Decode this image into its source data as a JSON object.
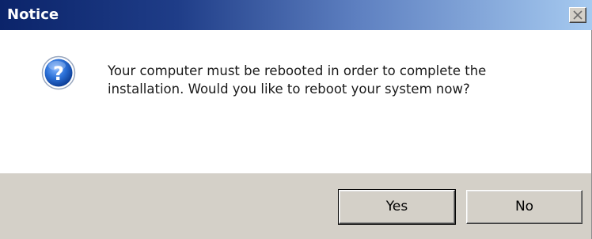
{
  "window": {
    "title": "Notice",
    "close_glyph": "✕"
  },
  "message": {
    "line1": "Your computer must be rebooted in order to complete the",
    "line2": "installation. Would you like to reboot your system now?"
  },
  "icon": {
    "name": "question-icon",
    "glyph": "?"
  },
  "buttons": {
    "yes_label": "Yes",
    "no_label": "No"
  },
  "colors": {
    "title_gradient_start": "#0b246a",
    "title_gradient_end": "#a6caf0",
    "button_face": "#d4d0c8",
    "icon_blue": "#1f5fbf"
  }
}
